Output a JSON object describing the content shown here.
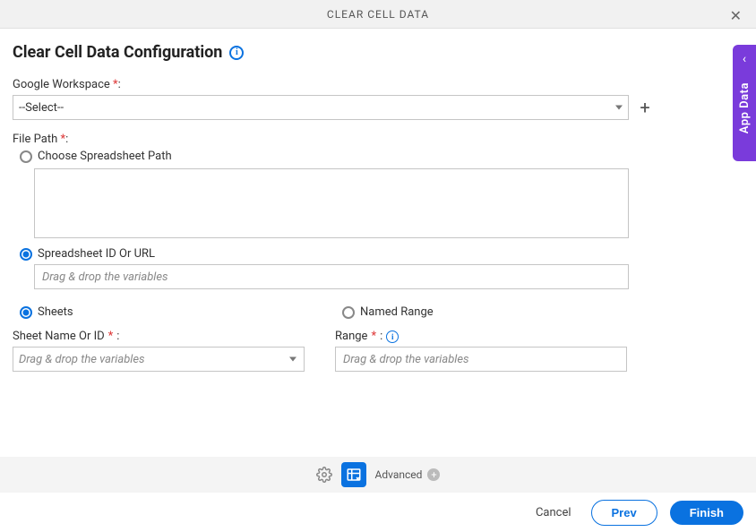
{
  "header": {
    "title": "CLEAR CELL DATA"
  },
  "page": {
    "title": "Clear Cell Data Configuration"
  },
  "form": {
    "workspace": {
      "label": "Google Workspace ",
      "required": "*",
      "colon": ":",
      "selected": "--Select--"
    },
    "filepath": {
      "label": "File Path ",
      "required": "*",
      "colon": ":",
      "choose_label": "Choose Spreadsheet Path",
      "idurl_label": "Spreadsheet ID Or URL",
      "idurl_placeholder": "Drag & drop the variables"
    },
    "sheets_radio": "Sheets",
    "named_range_radio": "Named Range",
    "sheet_name": {
      "label": "Sheet Name Or ID ",
      "required": "*",
      "colon": ":",
      "placeholder": "Drag & drop the variables"
    },
    "range": {
      "label": "Range ",
      "required": "*",
      "colon": ":",
      "placeholder": "Drag & drop the variables"
    }
  },
  "toolbar": {
    "advanced": "Advanced"
  },
  "footer": {
    "cancel": "Cancel",
    "prev": "Prev",
    "finish": "Finish"
  },
  "side": {
    "label": "App Data"
  }
}
